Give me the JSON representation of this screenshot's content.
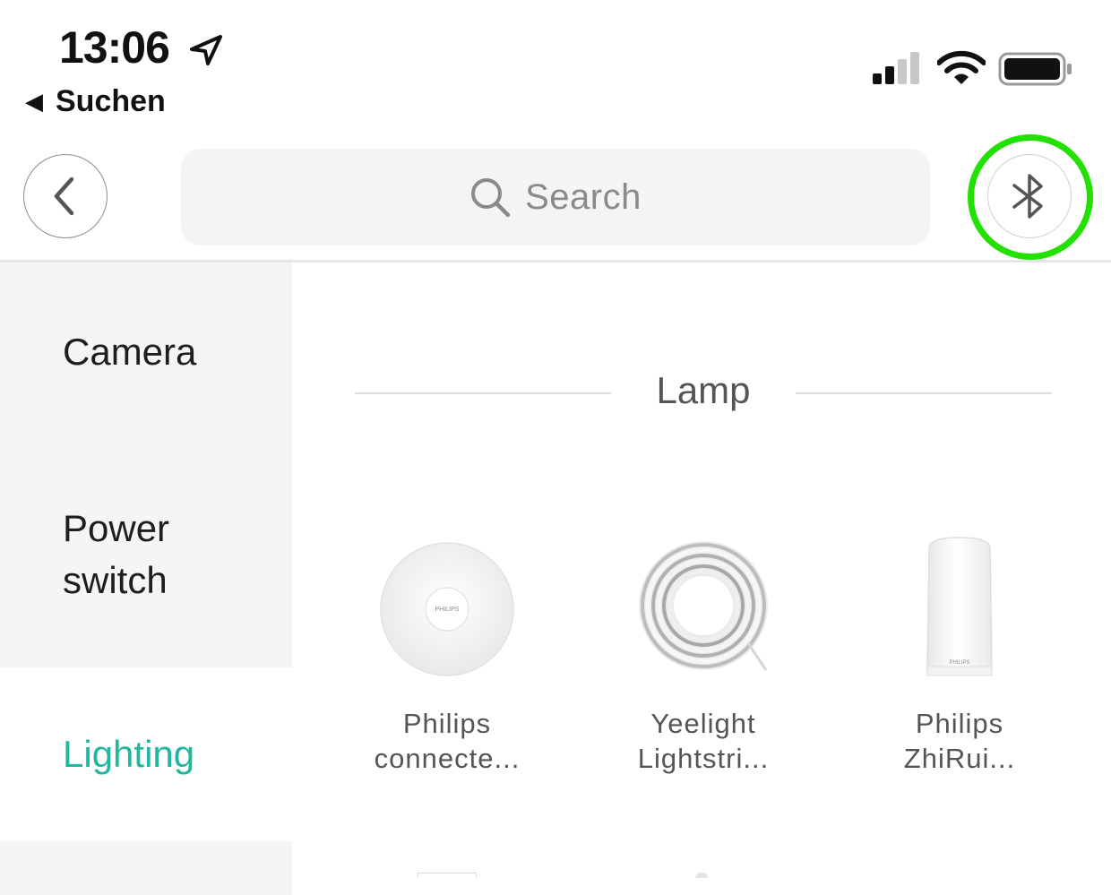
{
  "status_bar": {
    "time": "13:06",
    "back_app_label": "Suchen"
  },
  "header": {
    "search_placeholder": "Search"
  },
  "sidebar": {
    "items": [
      {
        "label": "Camera",
        "active": false
      },
      {
        "label": "Power\nswitch",
        "active": false
      },
      {
        "label": "Lighting",
        "active": true
      },
      {
        "label": "",
        "active": false
      }
    ]
  },
  "section": {
    "title": "Lamp"
  },
  "products": [
    {
      "name": "Philips\nconnecte...",
      "brand_mark": "PHILIPS",
      "icon": "ceiling-lamp"
    },
    {
      "name": "Yeelight\nLightstri...",
      "icon": "light-strip"
    },
    {
      "name": "Philips\nZhiRui...",
      "brand_mark": "PHILIPS",
      "icon": "desk-lamp"
    }
  ],
  "colors": {
    "accent": "#1fb89e",
    "highlight_ring": "#22e000",
    "sidebar_bg": "#f5f5f5"
  }
}
